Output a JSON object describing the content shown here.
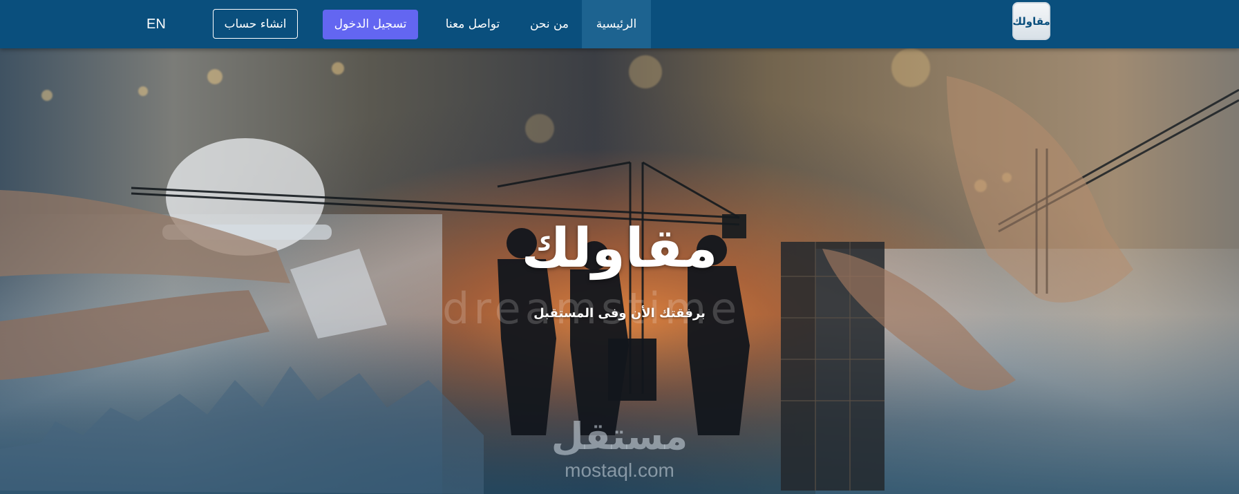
{
  "navbar": {
    "logo_text": "مقاولك",
    "items": [
      {
        "label": "الرئيسية",
        "active": true
      },
      {
        "label": "من نحن",
        "active": false
      },
      {
        "label": "تواصل معنا",
        "active": false
      }
    ],
    "login_label": "تسجيل الدخول",
    "register_label": "انشاء حساب",
    "language_label": "EN"
  },
  "hero": {
    "title": "مقاولك",
    "subtitle": "برفقتك الأن وفى المستقبل",
    "watermarks": {
      "stock": "dreamstime",
      "site_ar": "مستقل",
      "site_en": "mostaql.com"
    }
  },
  "colors": {
    "navbar_bg": "#0a4f7d",
    "active_item_bg": "#1d6390",
    "login_button_bg": "#6366f1",
    "text": "#ffffff"
  }
}
